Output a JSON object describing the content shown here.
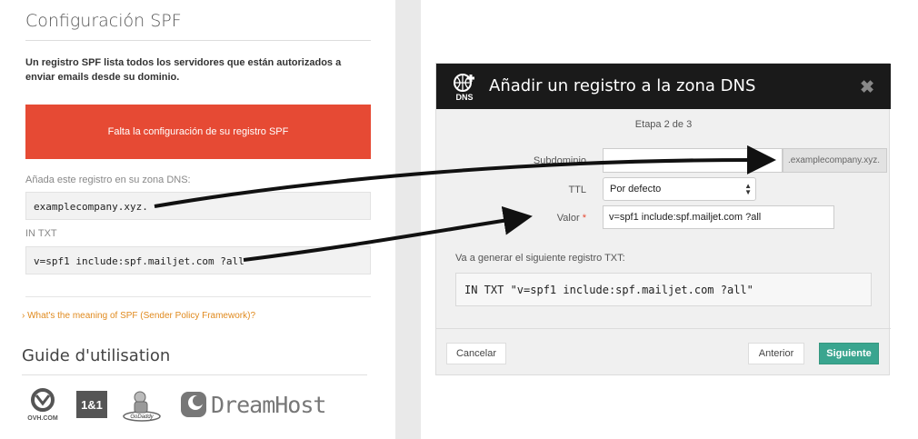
{
  "left": {
    "title": "Configuración SPF",
    "description": "Un registro SPF lista todos los servidores que están autorizados a enviar emails desde su dominio.",
    "alert": "Falta la configuración de su registro SPF",
    "add_label": "Añada este registro en su zona DNS:",
    "domain_value": "examplecompany.xyz.",
    "record_type_label": "IN TXT",
    "spf_value": "v=spf1 include:spf.mailjet.com ?all",
    "help_link": "What's the meaning of SPF (Sender Policy Framework)?",
    "guide_title": "Guide d'utilisation",
    "logos": {
      "ovh": "OVH.COM",
      "oneandone": "1&1",
      "godaddy": "GoDaddy",
      "dreamhost": "DreamHost"
    }
  },
  "modal": {
    "title": "Añadir un registro a la zona DNS",
    "icon_label": "DNS",
    "close": "✖",
    "step": "Etapa 2 de 3",
    "subdomain_label": "Subdominio",
    "subdomain_value": "",
    "subdomain_suffix": ".examplecompany.xyz.",
    "ttl_label": "TTL",
    "ttl_value": "Por defecto",
    "value_label": "Valor",
    "value_required": "*",
    "value_value": "v=spf1 include:spf.mailjet.com ?all",
    "generate_label": "Va a generar el siguiente registro TXT:",
    "generated_record": "IN TXT \"v=spf1 include:spf.mailjet.com ?all\"",
    "cancel": "Cancelar",
    "previous": "Anterior",
    "next": "Siguiente"
  },
  "colors": {
    "alert_red": "#e64a34",
    "link_orange": "#e08a1e",
    "next_green": "#3aa58f",
    "modal_header": "#1a1a1a"
  }
}
